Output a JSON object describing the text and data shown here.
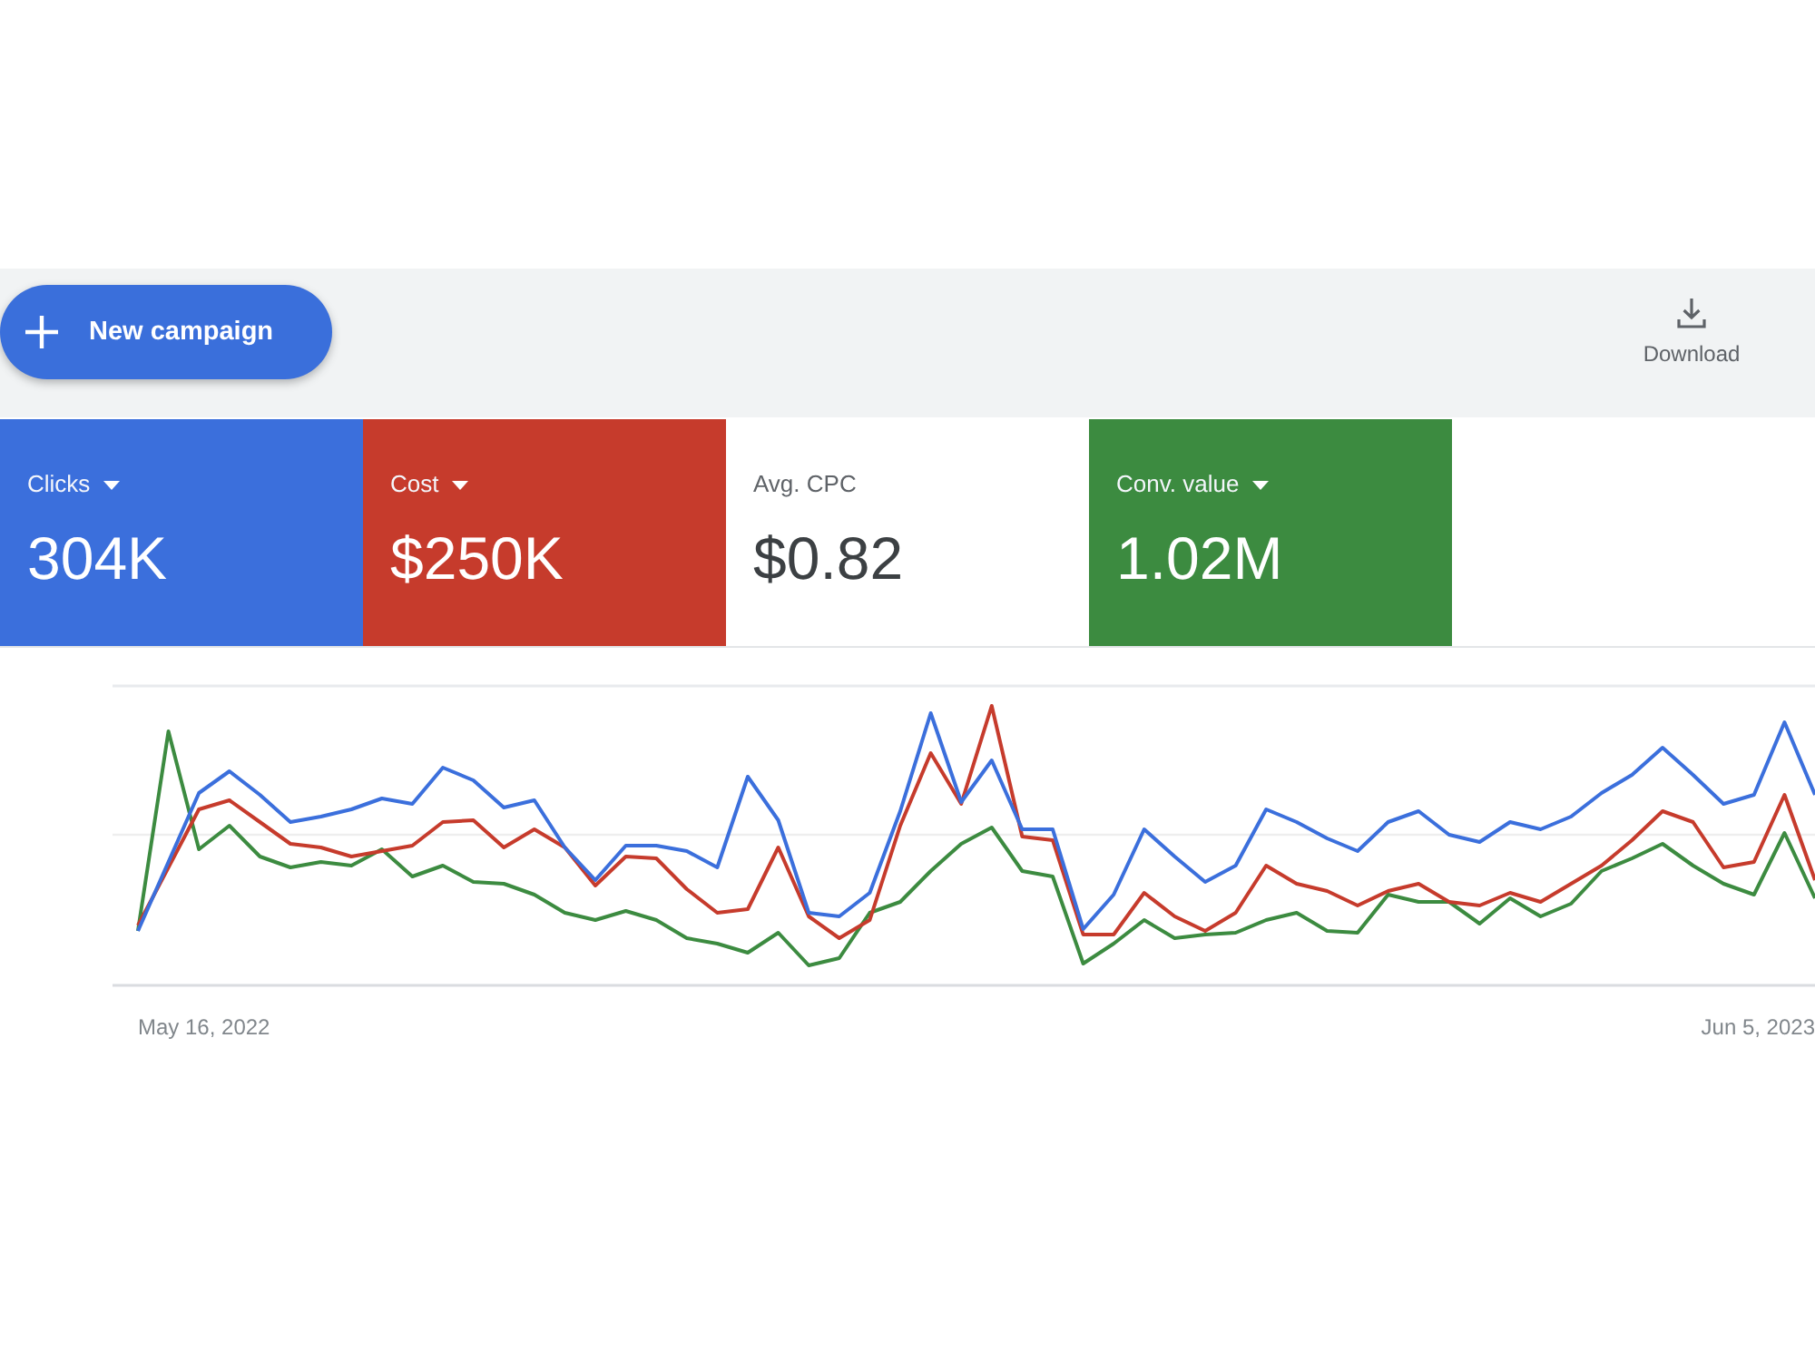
{
  "toolbar": {
    "new_campaign_button": "New campaign",
    "download_button": "Download"
  },
  "metrics": [
    {
      "label": "Clicks",
      "value": "304K",
      "selected": true,
      "color": "#3b6fdc",
      "dropdown": true
    },
    {
      "label": "Cost",
      "value": "$250K",
      "selected": true,
      "color": "#c63b2c",
      "dropdown": true
    },
    {
      "label": "Avg. CPC",
      "value": "$0.82",
      "selected": false,
      "dropdown": false
    },
    {
      "label": "Conv. value",
      "value": "1.02M",
      "selected": true,
      "color": "#3c8b40",
      "dropdown": true
    }
  ],
  "chart": {
    "x_start_label": "May 16, 2022",
    "x_end_label": "Jun 5, 2023"
  }
}
